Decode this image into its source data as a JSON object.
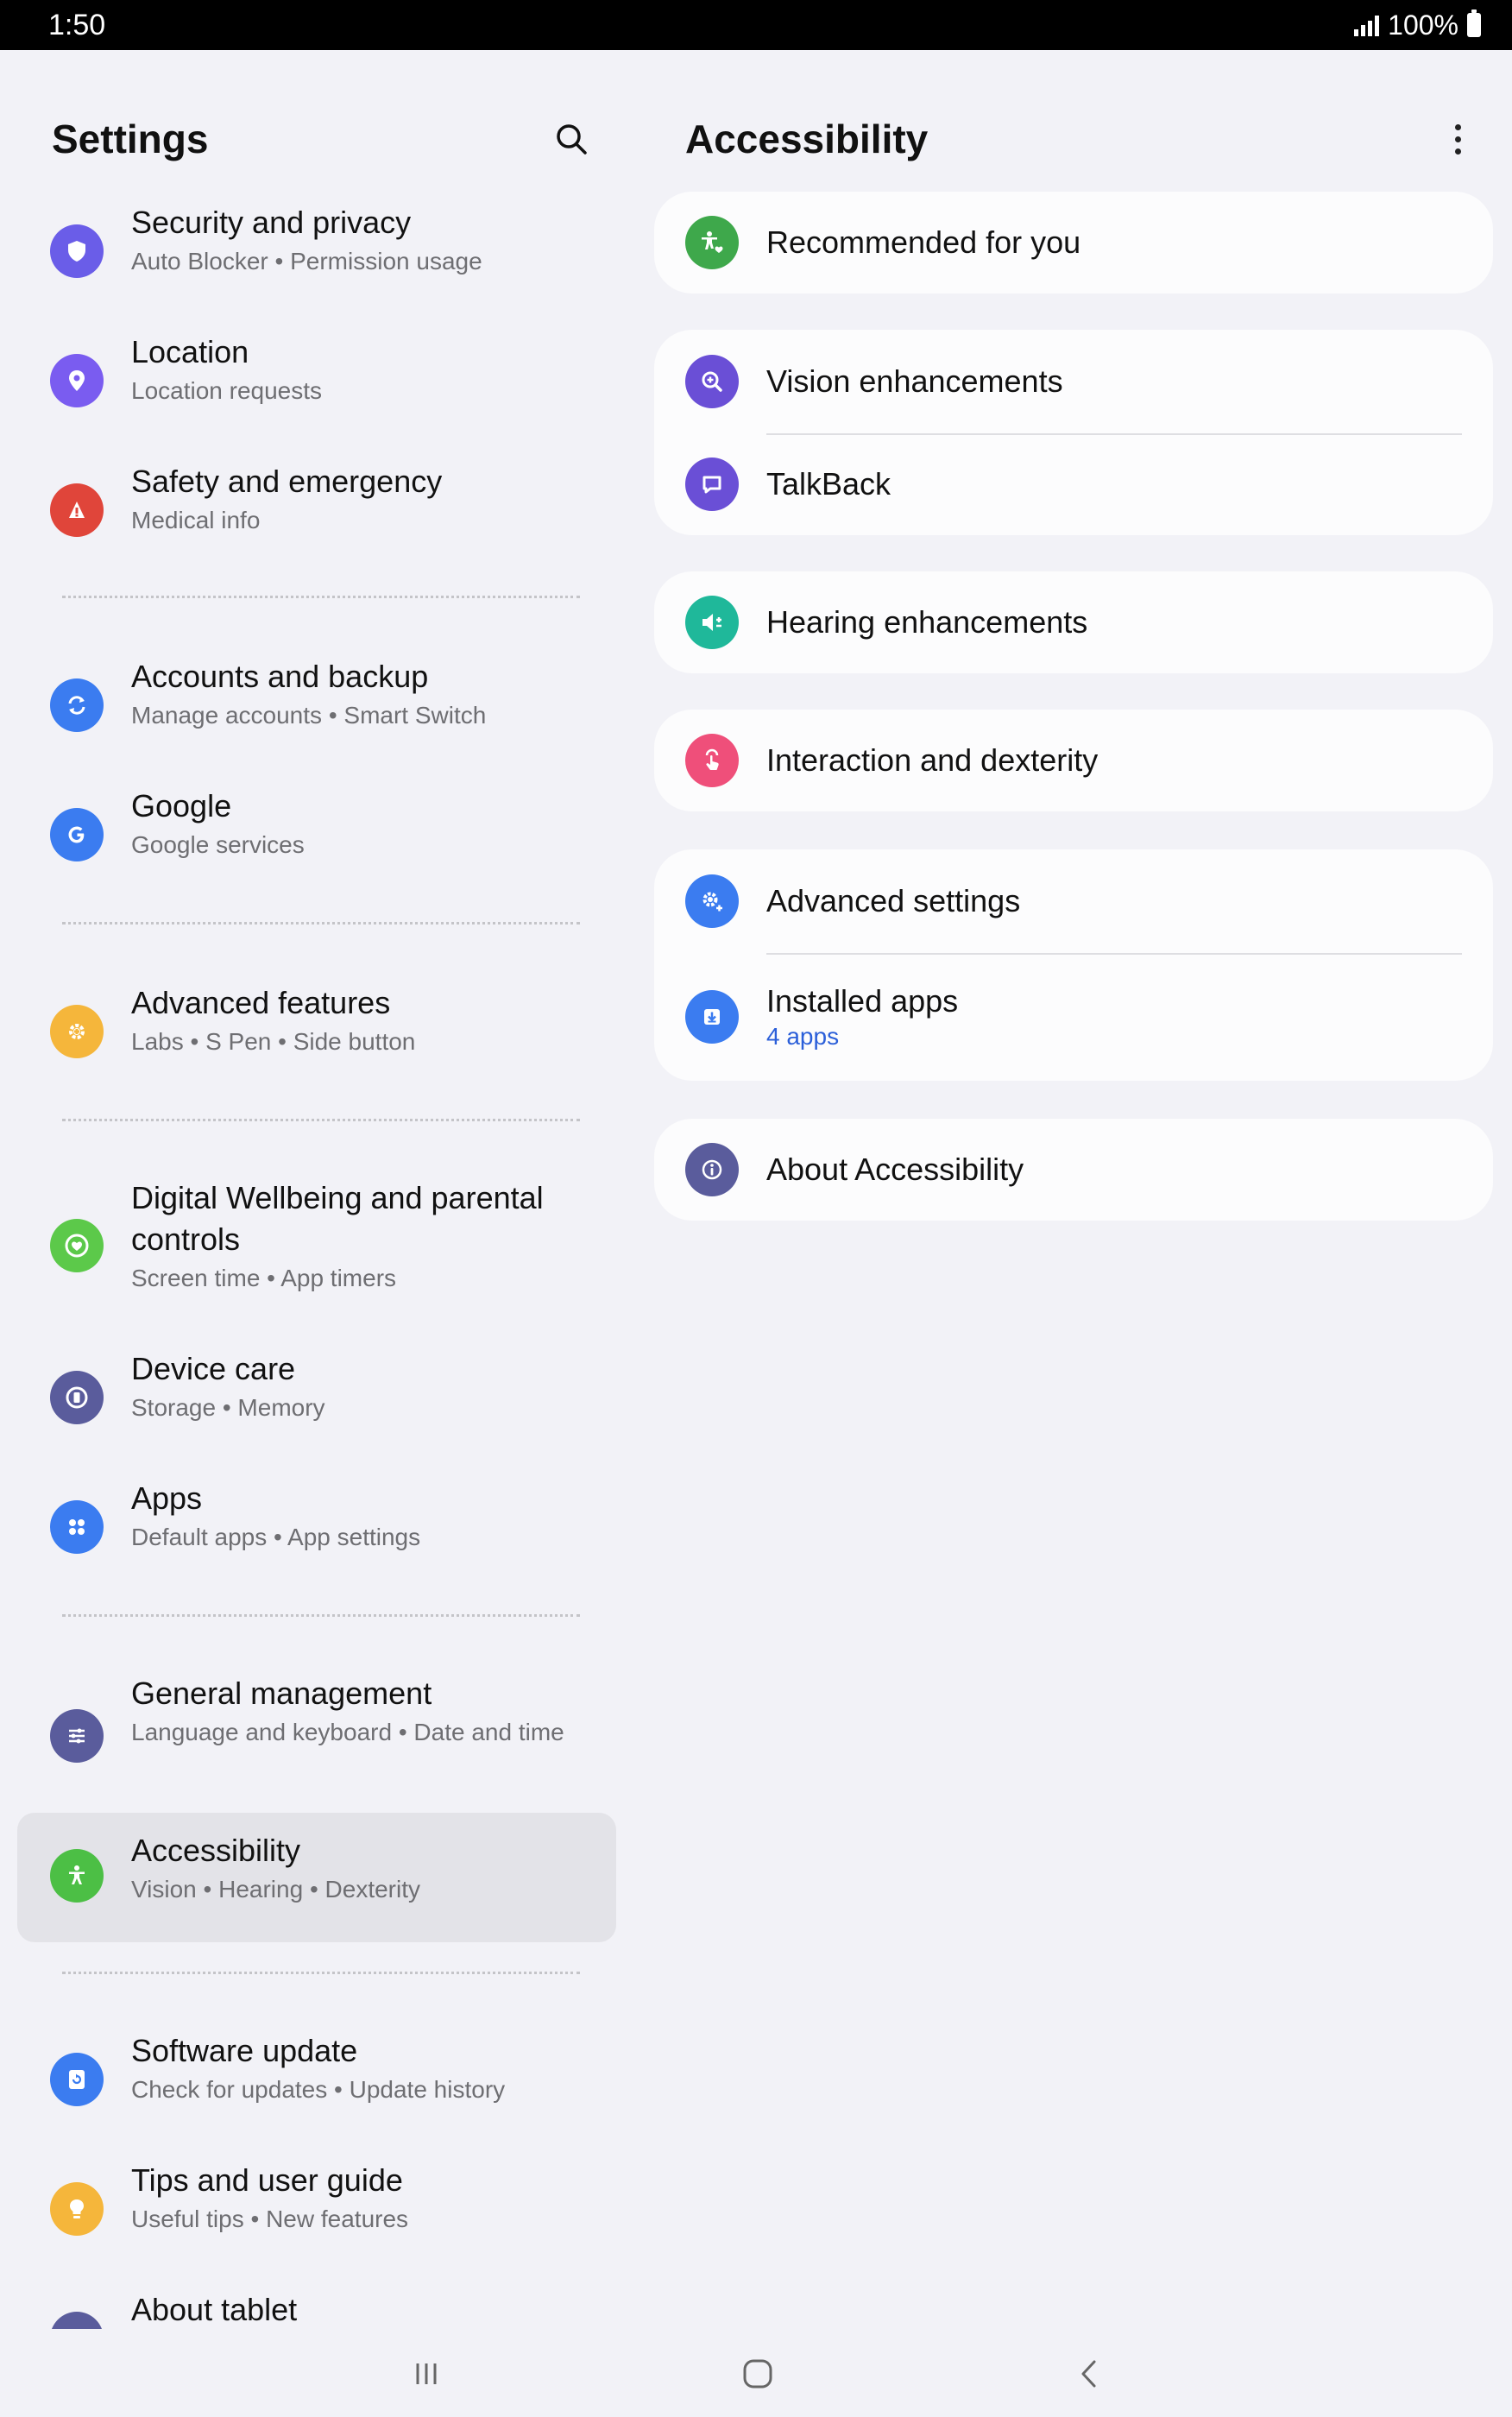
{
  "status_bar": {
    "time": "1:50",
    "battery": "100%"
  },
  "left": {
    "title": "Settings",
    "items": [
      {
        "title": "Security and privacy",
        "sub": "Auto Blocker  •  Permission usage",
        "icon": "shield-icon",
        "color": "#6a5de8"
      },
      {
        "title": "Location",
        "sub": "Location requests",
        "icon": "location-pin-icon",
        "color": "#7a5cf0"
      },
      {
        "title": "Safety and emergency",
        "sub": "Medical info",
        "icon": "emergency-icon",
        "color": "#e0453a"
      },
      {
        "title": "Accounts and backup",
        "sub": "Manage accounts  •  Smart Switch",
        "icon": "sync-icon",
        "color": "#3b7cf0"
      },
      {
        "title": "Google",
        "sub": "Google services",
        "icon": "google-icon",
        "color": "#3b7cf0"
      },
      {
        "title": "Advanced features",
        "sub": "Labs  •  S Pen  •  Side button",
        "icon": "gear-plus-icon",
        "color": "#f5b63b"
      },
      {
        "title": "Digital Wellbeing and parental controls",
        "sub": "Screen time  •  App timers",
        "icon": "wellbeing-icon",
        "color": "#5cc94a"
      },
      {
        "title": "Device care",
        "sub": "Storage  •  Memory",
        "icon": "device-care-icon",
        "color": "#5a5c9c"
      },
      {
        "title": "Apps",
        "sub": "Default apps  •  App settings",
        "icon": "apps-grid-icon",
        "color": "#3b7cf0"
      },
      {
        "title": "General management",
        "sub": "Language and keyboard  •  Date and time",
        "icon": "sliders-icon",
        "color": "#5a5c9c"
      },
      {
        "title": "Accessibility",
        "sub": "Vision  •  Hearing  •  Dexterity",
        "icon": "accessibility-icon",
        "color": "#4cbf45"
      },
      {
        "title": "Software update",
        "sub": "Check for updates  •  Update history",
        "icon": "update-icon",
        "color": "#3b7cf0"
      },
      {
        "title": "Tips and user guide",
        "sub": "Useful tips  •  New features",
        "icon": "lightbulb-icon",
        "color": "#f5b63b"
      },
      {
        "title": "About tablet",
        "sub": "",
        "icon": "info-icon",
        "color": "#5a5c9c"
      }
    ]
  },
  "right": {
    "title": "Accessibility",
    "cards": [
      [
        {
          "title": "Recommended for you",
          "icon": "accessibility-heart-icon",
          "color": "#3ea84b"
        }
      ],
      [
        {
          "title": "Vision enhancements",
          "icon": "magnifier-icon",
          "color": "#6a4fd6"
        },
        {
          "title": "TalkBack",
          "icon": "talkback-icon",
          "color": "#6a4fd6"
        }
      ],
      [
        {
          "title": "Hearing enhancements",
          "icon": "speaker-icon",
          "color": "#1fb89a"
        }
      ],
      [
        {
          "title": "Interaction and dexterity",
          "icon": "touch-hand-icon",
          "color": "#ef4f7a"
        }
      ],
      [
        {
          "title": "Advanced settings",
          "icon": "gear-plus-icon",
          "color": "#3b7cf0"
        },
        {
          "title": "Installed apps",
          "sub": "4 apps",
          "icon": "download-icon",
          "color": "#3b7cf0"
        }
      ],
      [
        {
          "title": "About Accessibility",
          "icon": "info-icon",
          "color": "#5a5c9c"
        }
      ]
    ]
  }
}
